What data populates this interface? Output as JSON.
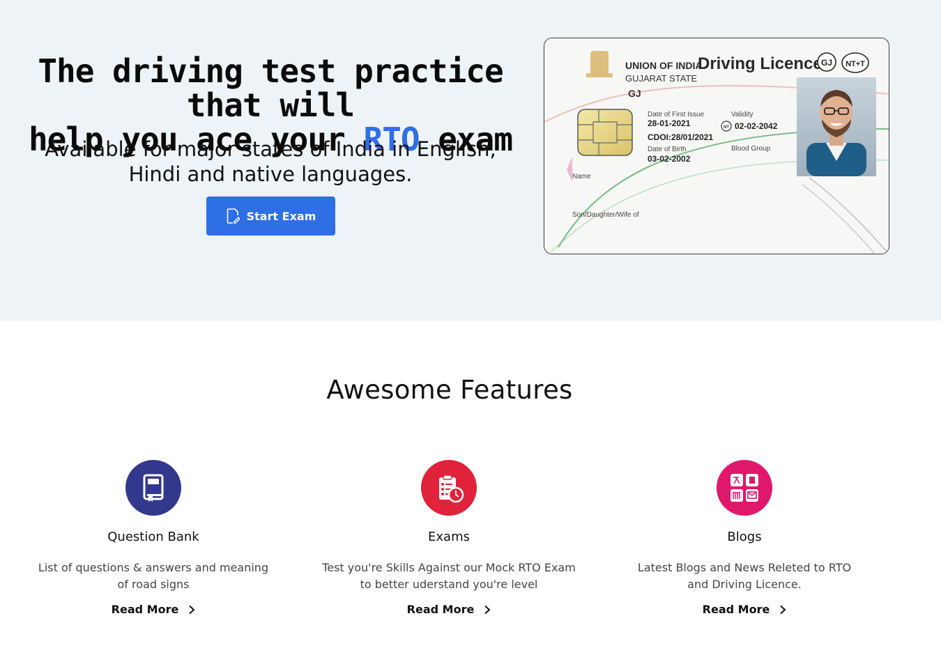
{
  "colors": {
    "accent": "#2f6fe6",
    "bank": "#32388c",
    "exams": "#e0233a",
    "blogs": "#e0186c"
  },
  "hero": {
    "title_line1": "The driving test practice that will",
    "title_pre": "help you ace your",
    "title_accent": "RTO",
    "title_post": "exam",
    "subtitle": "Available for major states of India in English, Hindi and native languages.",
    "start_button": "Start Exam",
    "start_icon": "edit-document-icon"
  },
  "licence": {
    "header_union": "UNION OF INDIA",
    "header_title": "Driving Licence",
    "badge_state": "GJ",
    "badge_class": "NT+T",
    "state": "GUJARAT STATE",
    "number_prefix": "GJ",
    "first_issue_label": "Date of First Issue",
    "first_issue_value": "28-01-2021",
    "cdoi_label": "CDOI:",
    "cdoi_value": "28/01/2021",
    "validity_label": "Validity",
    "validity_badge": "NT",
    "validity_value": "02-02-2042",
    "dob_label": "Date of Birth",
    "dob_value": "03-02-2002",
    "blood_label": "Blood Group",
    "name_label": "Name",
    "relation_label": "Son/Daughter/Wife of"
  },
  "features": {
    "title": "Awesome Features",
    "items": [
      {
        "title": "Question Bank",
        "desc": "List of questions & answers and meaning of road signs",
        "link": "Read More",
        "icon": "book-icon"
      },
      {
        "title": "Exams",
        "desc": "Test you're Skills Against our Mock RTO Exam to better uderstand you're level",
        "link": "Read More",
        "icon": "clipboard-clock-icon"
      },
      {
        "title": "Blogs",
        "desc": "Latest Blogs and News Releted to RTO and Driving Licence.",
        "link": "Read More",
        "icon": "blog-grid-icon"
      }
    ]
  }
}
